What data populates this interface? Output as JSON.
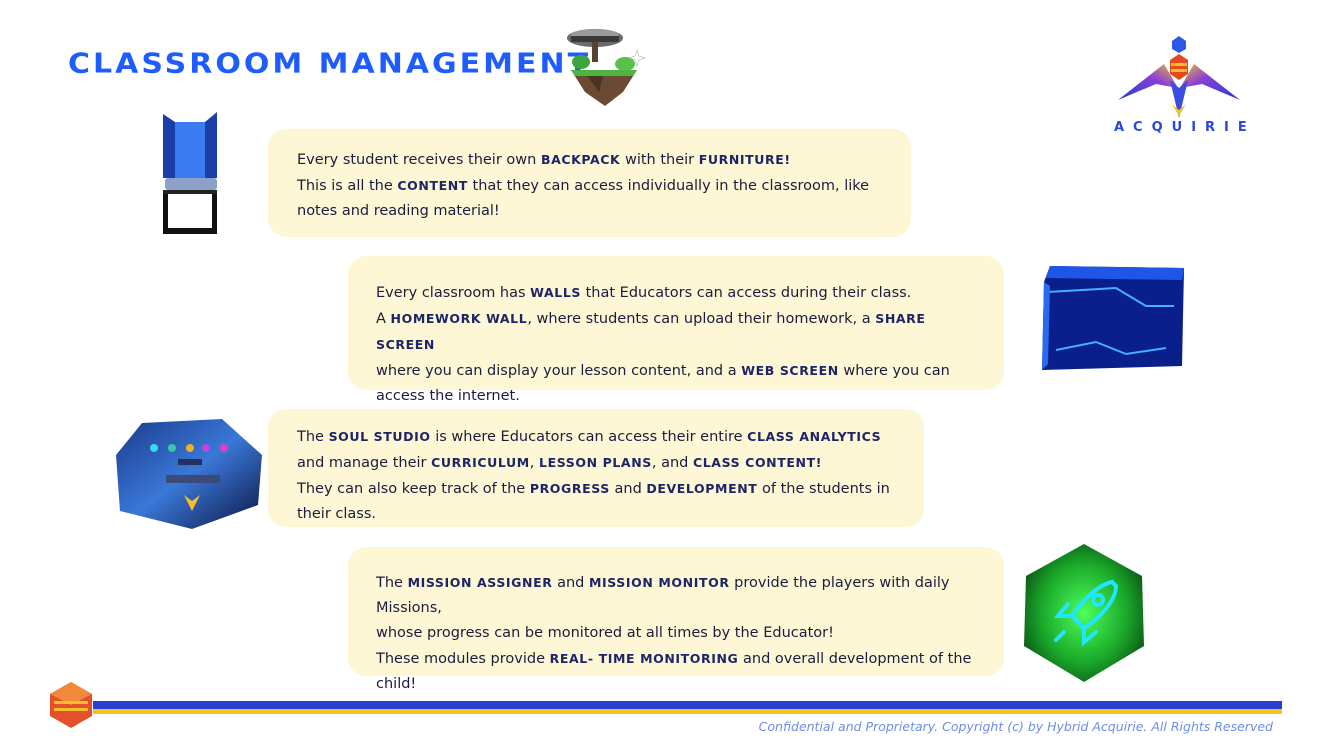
{
  "header": {
    "title": "Classroom Management",
    "logo_text": "ACQUIRIE"
  },
  "cards": [
    {
      "lines": [
        [
          "Every student receives their own ",
          "Backpack",
          " with their ",
          "Furniture!",
          ""
        ],
        [
          "This is all the ",
          "content",
          " that they can access individually in the classroom, like"
        ],
        [
          "notes and reading material!"
        ]
      ]
    },
    {
      "lines": [
        [
          "Every classroom has ",
          "walls",
          " that Educators can access during their class."
        ],
        [
          "A ",
          "homework wall",
          ", where students can upload their homework, a ",
          "share screen",
          ""
        ],
        [
          "where you can display your lesson content, and a ",
          "web screen",
          " where you can"
        ],
        [
          "access the internet."
        ]
      ]
    },
    {
      "lines": [
        [
          "The ",
          "Soul Studio",
          " is where Educators can access their entire ",
          "class analytics",
          ""
        ],
        [
          "and manage their ",
          "curriculum",
          ", ",
          "lesson plans",
          ", and ",
          "class content!",
          ""
        ],
        [
          "They can also keep track of the ",
          "progress",
          " and ",
          "development",
          " of the students in"
        ],
        [
          "their class."
        ]
      ]
    },
    {
      "lines": [
        [
          "The ",
          "Mission Assigner",
          " and ",
          "Mission Monitor",
          " provide the players with daily Missions,"
        ],
        [
          "whose progress can be monitored at all times by the Educator!"
        ],
        [
          "These modules provide ",
          "real- time monitoring",
          " and overall development of the"
        ],
        [
          "child!"
        ]
      ]
    }
  ],
  "icons": {
    "island": "floating-island-icon",
    "logo": "acquirie-bird-logo",
    "chair": "chair-icon",
    "wall": "wall-screen-icon",
    "studio": "soul-studio-icon",
    "rocket": "rocket-icon",
    "footer": "hexagon-emblem-icon"
  },
  "colors": {
    "title": "#1e5cff",
    "card_bg": "#fdf7d6",
    "bar_blue": "#2a3fd0",
    "bar_yellow": "#f2c51c",
    "copyright": "#6d8de6"
  },
  "footer": {
    "copyright": "Confidential and Proprietary. Copyright (c) by Hybrid Acquirie. All Rights Reserved"
  }
}
